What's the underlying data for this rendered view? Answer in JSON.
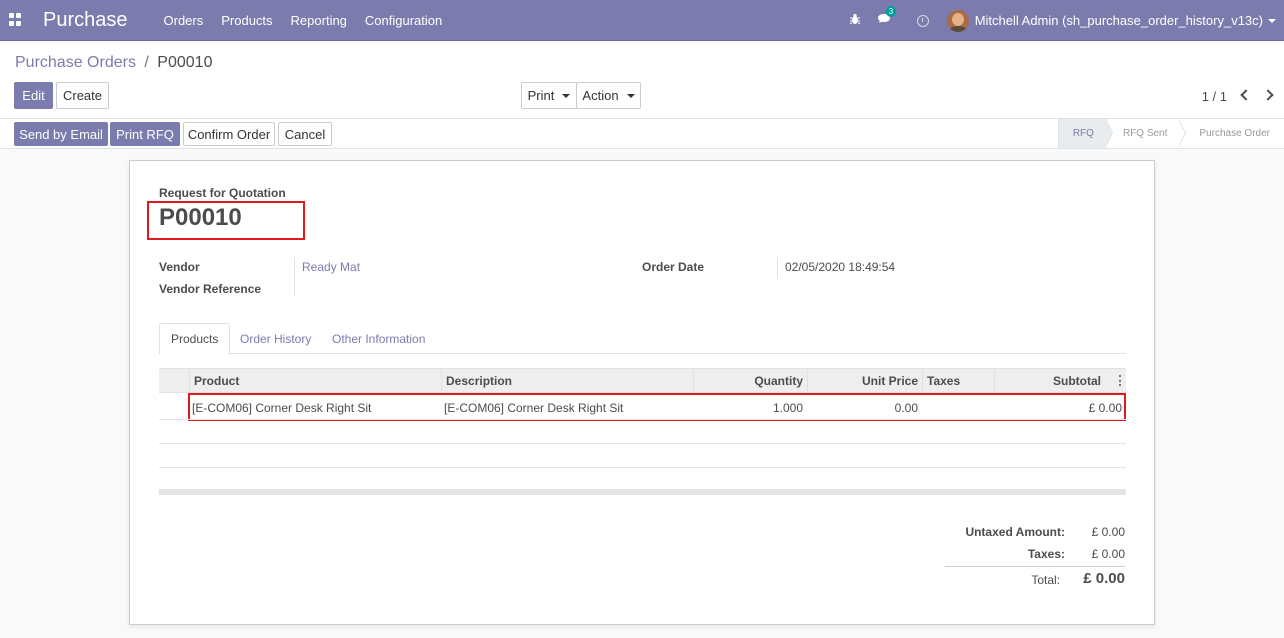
{
  "app": {
    "title": "Purchase"
  },
  "menu": [
    "Orders",
    "Products",
    "Reporting",
    "Configuration"
  ],
  "topbar": {
    "message_count": "3",
    "user": "Mitchell Admin (sh_purchase_order_history_v13c)"
  },
  "breadcrumb": {
    "parent": "Purchase Orders",
    "separator": "/",
    "current": "P00010"
  },
  "buttons": {
    "edit": "Edit",
    "create": "Create",
    "print": "Print",
    "action": "Action"
  },
  "pager": {
    "value": "1 / 1"
  },
  "header_buttons": {
    "send_email": "Send by Email",
    "print_rfq": "Print RFQ",
    "confirm": "Confirm Order",
    "cancel": "Cancel"
  },
  "stages": [
    "RFQ",
    "RFQ Sent",
    "Purchase Order"
  ],
  "document": {
    "type": "Request for Quotation",
    "name": "P00010",
    "vendor_label": "Vendor",
    "vendor_value": "Ready Mat",
    "vendor_ref_label": "Vendor Reference",
    "order_date_label": "Order Date",
    "order_date_value": "02/05/2020 18:49:54"
  },
  "tabs": [
    "Products",
    "Order History",
    "Other Information"
  ],
  "table": {
    "columns": [
      "Product",
      "Description",
      "Quantity",
      "Unit Price",
      "Taxes",
      "Subtotal"
    ],
    "rows": [
      {
        "product": "[E-COM06] Corner Desk Right Sit",
        "description": "[E-COM06] Corner Desk Right Sit",
        "quantity": "1.000",
        "unit_price": "0.00",
        "taxes": "",
        "subtotal": "£ 0.00"
      }
    ]
  },
  "totals": {
    "untaxed_label": "Untaxed Amount:",
    "untaxed_value": "£ 0.00",
    "taxes_label": "Taxes:",
    "taxes_value": "£ 0.00",
    "total_label": "Total:",
    "total_value": "£ 0.00"
  },
  "colors": {
    "brand": "#7c7bad",
    "highlight": "#e0191f"
  }
}
